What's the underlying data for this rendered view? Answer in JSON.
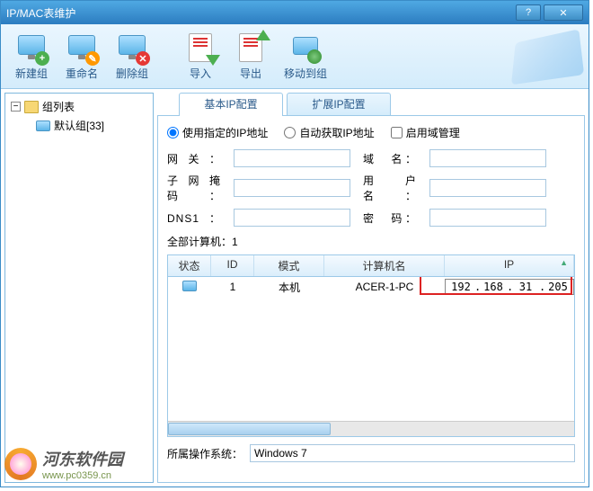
{
  "window": {
    "title": "IP/MAC表维护"
  },
  "toolbar": {
    "new_group": "新建组",
    "rename": "重命名",
    "delete_group": "删除组",
    "import": "导入",
    "export": "导出",
    "move_to_group": "移动到组"
  },
  "sidebar": {
    "root": "组列表",
    "default_group": "默认组[33]"
  },
  "tabs": {
    "basic": "基本IP配置",
    "extended": "扩展IP配置"
  },
  "radios": {
    "use_specified": "使用指定的IP地址",
    "auto_obtain": "自动获取IP地址",
    "enable_domain": "启用域管理"
  },
  "form": {
    "gateway_label": "网关：",
    "gateway_value": "",
    "domain_label": "域　名：",
    "domain_value": "",
    "subnet_label": "子网掩码：",
    "subnet_value": "",
    "user_label": "用 户 名：",
    "user_value": "",
    "dns1_label": "DNS1：",
    "dns1_value": "",
    "password_label": "密　码：",
    "password_value": ""
  },
  "count_label": "全部计算机：",
  "count_value": "1",
  "grid": {
    "headers": {
      "status": "状态",
      "id": "ID",
      "mode": "模式",
      "name": "计算机名",
      "ip": "IP"
    },
    "rows": [
      {
        "id": "1",
        "mode": "本机",
        "name": "ACER-1-PC",
        "ip": [
          "192",
          "168",
          "31",
          "205"
        ]
      }
    ]
  },
  "os_label": "所属操作系统：",
  "os_value": "Windows 7",
  "watermark": {
    "name": "河东软件园",
    "url": "www.pc0359.cn"
  }
}
